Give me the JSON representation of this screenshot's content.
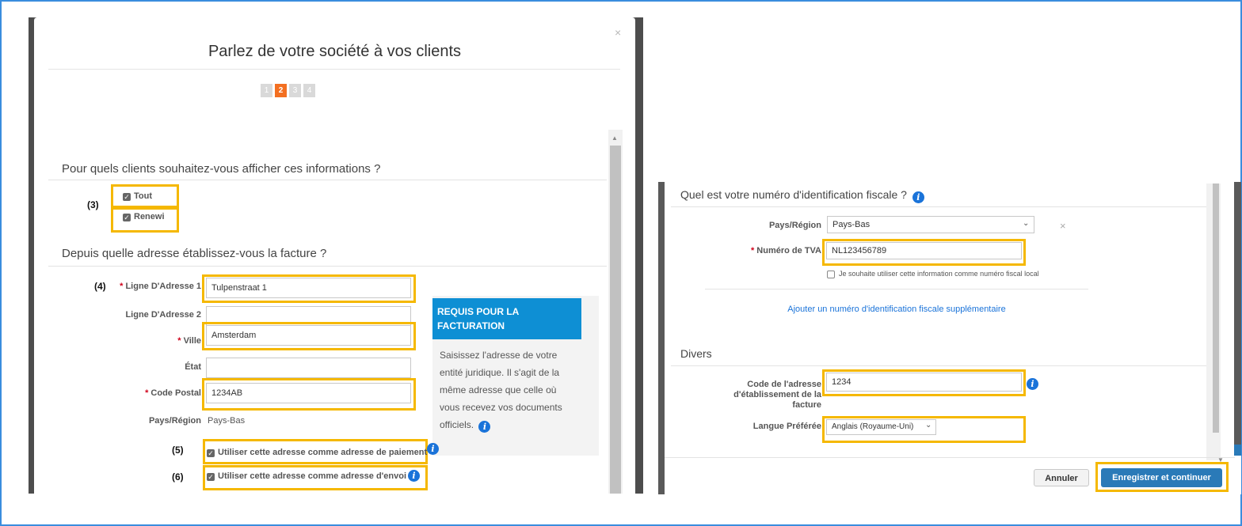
{
  "left": {
    "title": "Parlez de votre société à vos clients",
    "close": "×",
    "steps": [
      "1",
      "2",
      "3",
      "4"
    ],
    "active_step": 2,
    "q_clients": "Pour quels clients souhaitez-vous afficher ces informations ?",
    "clients_opts": [
      "Tout",
      "Renewi"
    ],
    "q_address": "Depuis quelle adresse établissez-vous la facture ?",
    "callouts": {
      "c3": "(3)",
      "c4": "(4)",
      "c5": "(5)",
      "c6": "(6)"
    },
    "fields": {
      "addr1_label": "Ligne D'Adresse 1",
      "addr1_value": "Tulpenstraat 1",
      "addr2_label": "Ligne D'Adresse 2",
      "addr2_value": "",
      "city_label": "Ville",
      "city_value": "Amsterdam",
      "state_label": "État",
      "state_value": "",
      "postal_label": "Code Postal",
      "postal_value": "1234AB",
      "country_label": "Pays/Région",
      "country_value": "Pays-Bas"
    },
    "use_payment": "Utiliser cette adresse comme adresse de paiement",
    "use_shipping": "Utiliser cette adresse comme adresse d'envoi",
    "req_heading": "REQUIS POUR LA FACTURATION",
    "req_text": "Saisissez l'adresse de votre entité juridique. Il s'agit de la même adresse que celle où vous recevez vos documents officiels."
  },
  "right": {
    "q_tax": "Quel est votre numéro d'identification fiscale ?",
    "country_label": "Pays/Région",
    "country_value": "Pays-Bas",
    "remove": "×",
    "vat_label": "Numéro de TVA",
    "vat_value": "NL123456789",
    "local_checkbox": "Je souhaite utiliser cette information comme numéro fiscal local",
    "add_tax_link": "Ajouter un numéro d'identification fiscale supplémentaire",
    "misc_heading": "Divers",
    "billing_code_label": "Code de l'adresse d'établissement de la facture",
    "billing_code_value": "1234",
    "lang_label": "Langue Préférée",
    "lang_value": "Anglais (Royaume-Uni)",
    "cancel": "Annuler",
    "save": "Enregistrer et continuer"
  },
  "colors": {
    "accent": "#f5b800",
    "primary": "#2a7ab8",
    "step_active": "#f36f21",
    "info": "#1a73d9"
  }
}
